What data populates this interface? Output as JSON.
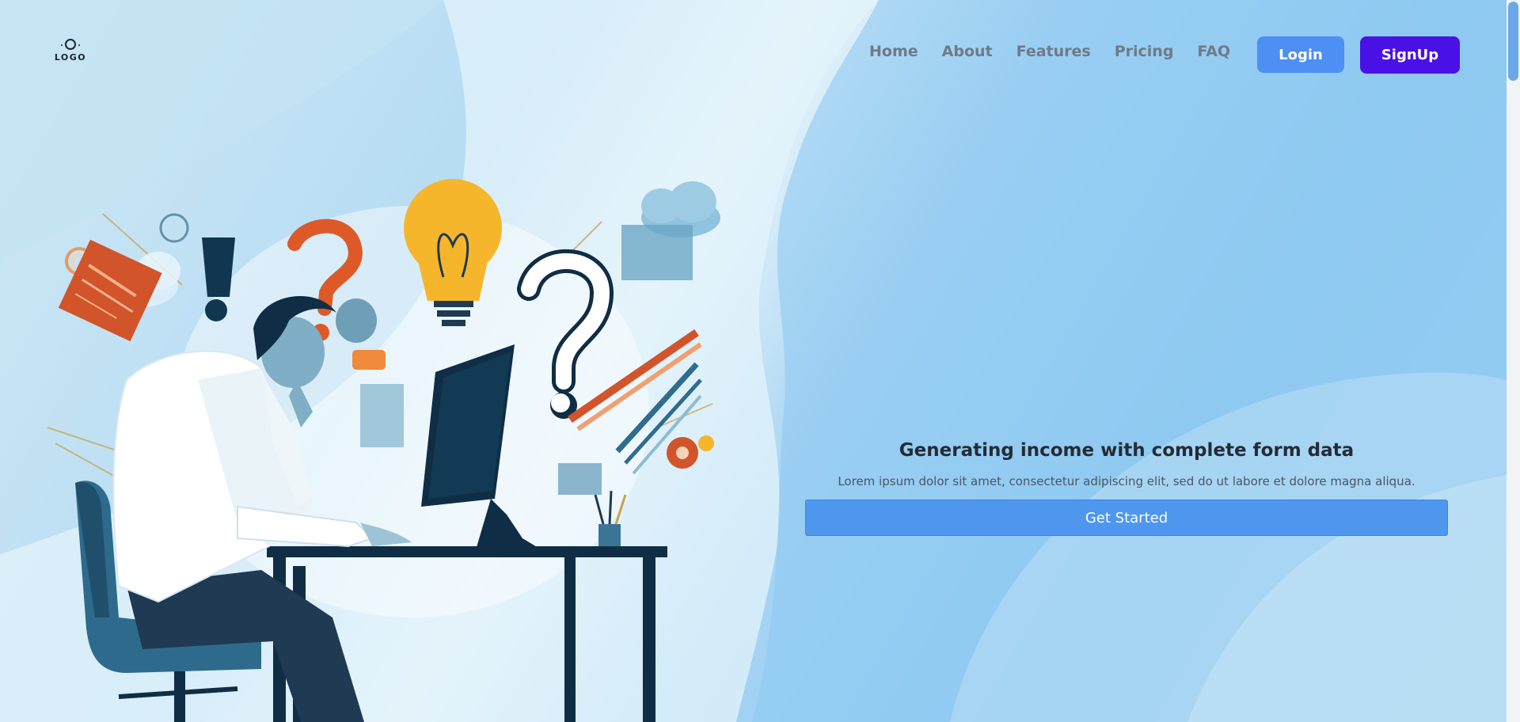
{
  "header": {
    "logo_text": "LOGO",
    "nav": [
      "Home",
      "About",
      "Features",
      "Pricing",
      "FAQ"
    ],
    "login_label": "Login",
    "signup_label": "SignUp"
  },
  "hero": {
    "title": "Generating income with complete form data",
    "subtitle": "Lorem ipsum dolor sit amet, consectetur adipiscing elit, sed do ut labore et dolore magna aliqua.",
    "cta_label": "Get Started"
  },
  "colors": {
    "login_button": "#4d8ff2",
    "signup_button": "#4a11e6",
    "cta_button": "#4f96ef",
    "nav_text": "#6f7a87",
    "title_text": "#252b35"
  },
  "illustration": {
    "icons": [
      "question-mark-icon",
      "exclamation-mark-icon",
      "lightbulb-icon",
      "cloud-icon",
      "gear-icon",
      "pencil-cup-icon",
      "monitor-icon",
      "desk-icon",
      "chair-icon"
    ]
  }
}
